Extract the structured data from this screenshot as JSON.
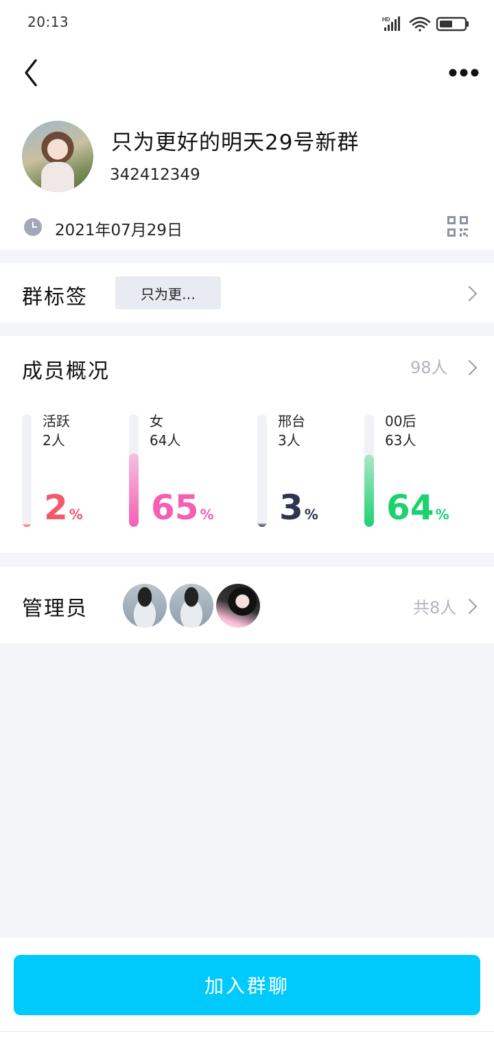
{
  "status_bar": {
    "time": "20:13",
    "icons": [
      "hd-signal-icon",
      "wifi-icon",
      "battery-icon"
    ]
  },
  "nav": {
    "back_icon": "chevron-left-icon",
    "more_icon": "more-dots-icon"
  },
  "group": {
    "name": "只为更好的明天29号新群",
    "id": "342412349",
    "created_date": "2021年07月29日",
    "qr_icon": "qr-code-icon"
  },
  "tags": {
    "title": "群标签",
    "chip_label": "只为更…"
  },
  "members": {
    "title": "成员概况",
    "count": "98人",
    "stats": [
      {
        "label": "活跃",
        "value": "2人",
        "percent": "2",
        "unit": "%",
        "color": "#f2596b",
        "fill_fraction": 0.02
      },
      {
        "label": "女",
        "value": "64人",
        "percent": "65",
        "unit": "%",
        "color": "#f45fb3",
        "fill_fraction": 0.65
      },
      {
        "label": "邢台",
        "value": "3人",
        "percent": "3",
        "unit": "%",
        "color": "#2e3550",
        "fill_fraction": 0.03
      },
      {
        "label": "00后",
        "value": "63人",
        "percent": "64",
        "unit": "%",
        "color": "#1dd170",
        "fill_fraction": 0.64
      }
    ]
  },
  "admins": {
    "title": "管理员",
    "count": "共8人",
    "avatar_count_shown": 3
  },
  "join": {
    "label": "加入群聊",
    "color": "#00cafc"
  }
}
